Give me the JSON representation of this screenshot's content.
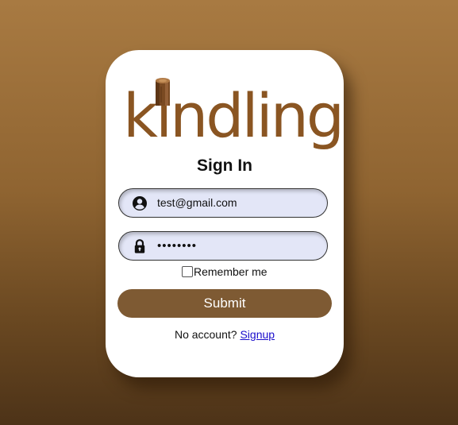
{
  "brand": {
    "logo_text": "kindling",
    "logo_color": "#8a5522"
  },
  "form": {
    "title": "Sign In",
    "email_value": "test@gmail.com",
    "password_value": "••••••••",
    "remember_label": "Remember me",
    "remember_checked": false,
    "submit_label": "Submit",
    "no_account_text": "No account?",
    "signup_label": "Signup"
  },
  "icons": {
    "email": "user-circle-icon",
    "password": "lock-icon",
    "logo": "log-icon"
  },
  "colors": {
    "background_top": "#a87a42",
    "background_bottom": "#4d3318",
    "submit_button": "#7e5a33",
    "input_background": "#e3e6f7",
    "link": "#1a0dcc"
  }
}
